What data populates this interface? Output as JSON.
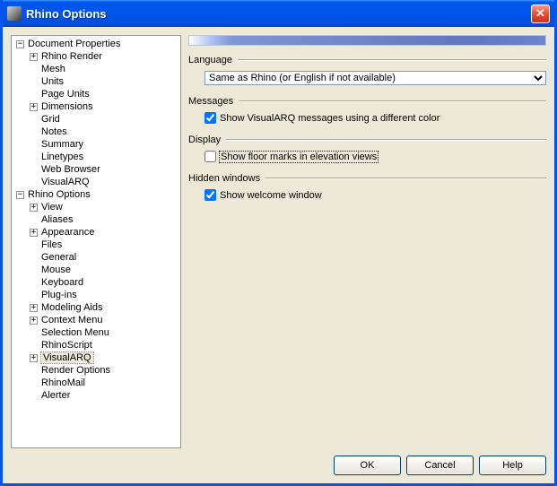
{
  "window": {
    "title": "Rhino Options"
  },
  "tree": {
    "doc_props": "Document Properties",
    "rhino_render": "Rhino Render",
    "mesh": "Mesh",
    "units": "Units",
    "page_units": "Page Units",
    "dimensions": "Dimensions",
    "grid": "Grid",
    "notes": "Notes",
    "summary": "Summary",
    "linetypes": "Linetypes",
    "web_browser": "Web Browser",
    "visualarq": "VisualARQ",
    "rhino_options": "Rhino Options",
    "view": "View",
    "aliases": "Aliases",
    "appearance": "Appearance",
    "files": "Files",
    "general": "General",
    "mouse": "Mouse",
    "keyboard": "Keyboard",
    "plugins": "Plug-ins",
    "modeling_aids": "Modeling Aids",
    "context_menu": "Context Menu",
    "selection_menu": "Selection Menu",
    "rhinoscript": "RhinoScript",
    "visualarq2": "VisualARQ",
    "render_options": "Render Options",
    "rhinomail": "RhinoMail",
    "alerter": "Alerter"
  },
  "groups": {
    "language": "Language",
    "messages": "Messages",
    "display": "Display",
    "hidden": "Hidden windows"
  },
  "language_select": {
    "value": "Same as Rhino (or English if not available)"
  },
  "messages_check": {
    "label": "Show VisualARQ messages using a different color",
    "checked": true
  },
  "display_check": {
    "label": "Show floor marks in elevation views",
    "checked": false
  },
  "hidden_check": {
    "label": "Show welcome window",
    "checked": true
  },
  "buttons": {
    "ok": "OK",
    "cancel": "Cancel",
    "help": "Help"
  }
}
